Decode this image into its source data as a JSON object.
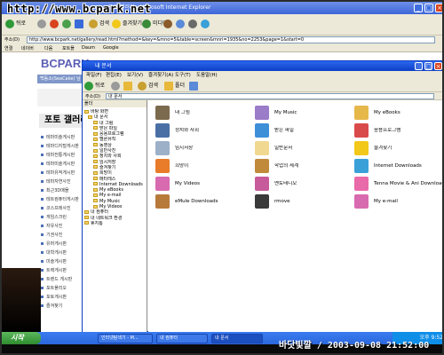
{
  "watermark": "http://www.bcpark.net",
  "ie": {
    "title": "포토 갤러리 - Microsoft Internet Explorer",
    "toolbar": [
      "뒤로",
      "검색",
      "즐겨찾기",
      "미디어"
    ],
    "address_label": "주소(D)",
    "url": "http://www.bcpark.net/gallery/read.html?method=&key=&mno=5&table=screen&mnri=1935&no=2253&page=1&start=0",
    "links": [
      "연결",
      "네이버",
      "다음",
      "포트폴",
      "Daum",
      "Google"
    ]
  },
  "site": {
    "logo": "BCPARK",
    "login": "백동소(SeaCake) 님",
    "gallery_title": "포토 갤러리",
    "side_items": [
      "테마미술게시판",
      "테마디지털게시판",
      "테마전통게시판",
      "테마미술게시판",
      "테마유적게시판",
      "테마자연사진",
      "최근3D매물",
      "테트컴퓨터게시판",
      "코스프레사진",
      "게임스크린",
      "자유사진",
      "기권사진",
      "유머게시판",
      "대학게시판",
      "미술게시판",
      "트랙게시판",
      "트렌드 게시판",
      "포트폴리오",
      "포토게시판",
      "즐겨찾기"
    ]
  },
  "explorer": {
    "title": "내 문서",
    "menu": [
      "파일(F)",
      "편집(E)",
      "보기(V)",
      "즐겨찾기(A)",
      "도구(T)",
      "도움말(H)"
    ],
    "tools": [
      "뒤로",
      "검색",
      "폴더"
    ],
    "address_label": "주소(D)",
    "address": "내 문서",
    "tree_header": "폴더",
    "tree": [
      "바탕 화면",
      "내 문서",
      "내 그림",
      "받은 파일",
      "응용프로그램",
      "멜론뮤직",
      "동영상",
      "일반사진",
      "정치와 사회",
      "임시저장",
      "즐겨찾기",
      "희망이",
      "메타레스",
      "Internet Downloads",
      "My eBooks",
      "My e-mail",
      "My Music",
      "My Videos",
      "내 컴퓨터",
      "내 네트워크 환경",
      "휴지통"
    ],
    "items": [
      {
        "label": "내 그림",
        "color": "#7c6a4e"
      },
      {
        "label": "My Music",
        "color": "#9b7cc8"
      },
      {
        "label": "My eBooks",
        "color": "#e6b84a"
      },
      {
        "label": "정치와 사회",
        "color": "#4a6fa5"
      },
      {
        "label": "받은 파일",
        "color": "#3d8fd8"
      },
      {
        "label": "응용프로그램",
        "color": "#d94b4b"
      },
      {
        "label": "임시저장",
        "color": "#9cb0c8"
      },
      {
        "label": "일반문서",
        "color": "#f0d890"
      },
      {
        "label": "즐겨찾기",
        "color": "#f2c81a"
      },
      {
        "label": "희망이",
        "color": "#e87c2a"
      },
      {
        "label": "학업의 세계",
        "color": "#c08a3a"
      },
      {
        "label": "Internet Downloads",
        "color": "#3aa0d8"
      },
      {
        "label": "My Videos",
        "color": "#d86ab0"
      },
      {
        "label": "멘토테디오",
        "color": "#c75a9a"
      },
      {
        "label": "Tenna Movie & Ani Downloads",
        "color": "#e96aa8"
      },
      {
        "label": "eMule Downloads",
        "color": "#b87a3a"
      },
      {
        "label": "rmove",
        "color": "#3a3a3a"
      },
      {
        "label": "My e-mail",
        "color": "#d86ab0"
      }
    ]
  },
  "taskbar": {
    "start": "시작",
    "tasks": [
      "인터넷탐색기 - M...",
      "내 컴퓨터",
      "내 문서"
    ],
    "time": "오후 9:52"
  },
  "stamp": "바닷빛깔 / 2003-09-08 21:52:00",
  "colors": {
    "title_blue": "#0c3fc4",
    "taskbar_blue": "#245edb",
    "face": "#ece9d8"
  }
}
